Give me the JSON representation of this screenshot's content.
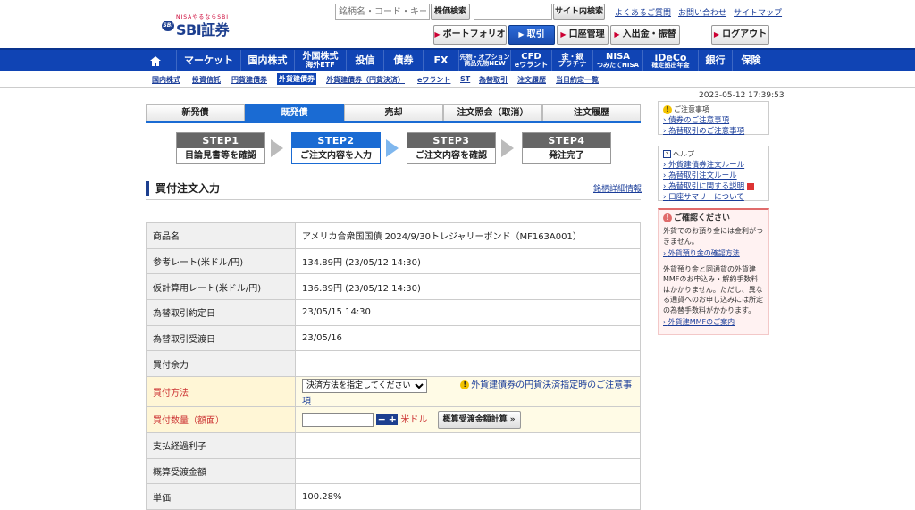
{
  "logo": {
    "small": "NISAやるならSBI",
    "badge": "SBI",
    "brand": "SBI証券"
  },
  "search": {
    "placeholder": "銘柄名・コード・キーワード",
    "stock_button": "株価検索",
    "site_button": "サイト内検索"
  },
  "toplinks": [
    "よくあるご質問",
    "お問い合わせ",
    "サイトマップ"
  ],
  "subtabs": {
    "portfolio": "ポートフォリオ",
    "trade": "取引",
    "account": "口座管理",
    "deposit": "入出金・振替",
    "logout": "ログアウト"
  },
  "nav": [
    {
      "label": "マーケット"
    },
    {
      "label": "国内株式"
    },
    {
      "label": "外国株式",
      "sub": "海外ETF"
    },
    {
      "label": "投信"
    },
    {
      "label": "債券"
    },
    {
      "label": "FX"
    },
    {
      "label": "先物・オプション",
      "sub": "商品先物NEW"
    },
    {
      "label": "CFD",
      "sub": "eワラント"
    },
    {
      "label": "金・銀",
      "sub": "プラチナ"
    },
    {
      "label": "NISA",
      "sub": "つみたてNISA"
    },
    {
      "label": "iDeCo",
      "sub": "確定拠出年金"
    },
    {
      "label": "銀行"
    },
    {
      "label": "保険"
    }
  ],
  "subnav": [
    "国内株式",
    "投資信託",
    "円貨建債券",
    "外貨建債券",
    "外貨建債券（円貨決済）",
    "eワラント",
    "ST",
    "為替取引",
    "注文履歴",
    "当日約定一覧"
  ],
  "tabs": [
    "新発債",
    "既発債",
    "売却",
    "注文照会（取消）",
    "注文履歴"
  ],
  "steps": [
    {
      "head": "STEP1",
      "body": "目論見書等を確認"
    },
    {
      "head": "STEP2",
      "body": "ご注文内容を入力"
    },
    {
      "head": "STEP3",
      "body": "ご注文内容を確認"
    },
    {
      "head": "STEP4",
      "body": "発注完了"
    }
  ],
  "section": {
    "title": "買付注文入力",
    "link": "銘柄詳細情報"
  },
  "rows": [
    {
      "label": "商品名",
      "value": "アメリカ合衆国国債 2024/9/30トレジャリーボンド（MF163A001）"
    },
    {
      "label": "参考レート(米ドル/円)",
      "value": "134.89円 (23/05/12 14:30)"
    },
    {
      "label": "仮計算用レート(米ドル/円)",
      "value": "136.89円 (23/05/12 14:30)"
    },
    {
      "label": "為替取引約定日",
      "value": "23/05/15 14:30"
    },
    {
      "label": "為替取引受渡日",
      "value": "23/05/16"
    },
    {
      "label": "買付余力",
      "value": ""
    },
    {
      "label": "買付方法",
      "select": "決済方法を指定してください",
      "link": "外貨建債券の円貨決済指定時のご注意事項"
    },
    {
      "label": "買付数量（額面）",
      "unit": "米ドル",
      "button": "概算受渡金額計算"
    },
    {
      "label": "支払経過利子",
      "value": ""
    },
    {
      "label": "概算受渡金額",
      "value": ""
    },
    {
      "label": "単価",
      "value": "100.28%"
    }
  ],
  "datetime": "2023-05-12 17:39:53",
  "notice": {
    "title": "ご注意事項",
    "links": [
      "債券のご注意事項",
      "為替取引のご注意事項"
    ]
  },
  "help": {
    "title": "ヘルプ",
    "links": [
      "外貨建債券注文ルール",
      "為替取引注文ルール",
      "為替取引に関する説明",
      "口座サマリーについて"
    ]
  },
  "confirm": {
    "title": "ご確認ください",
    "text1": "外貨でのお預り金には金利がつきません。",
    "link1": "外貨預り金の確認方法",
    "text2": "外貨預り金と同通貨の外貨建MMFのお申込み・解約手数料はかかりません。ただし、異なる通貨へのお申し込みには所定の為替手数料がかかります。",
    "link2": "外貨建MMFのご案内"
  },
  "colors": {
    "nav": "#1044b4",
    "active_tab": "#1a6bd3",
    "highlight_label": "#c33"
  }
}
